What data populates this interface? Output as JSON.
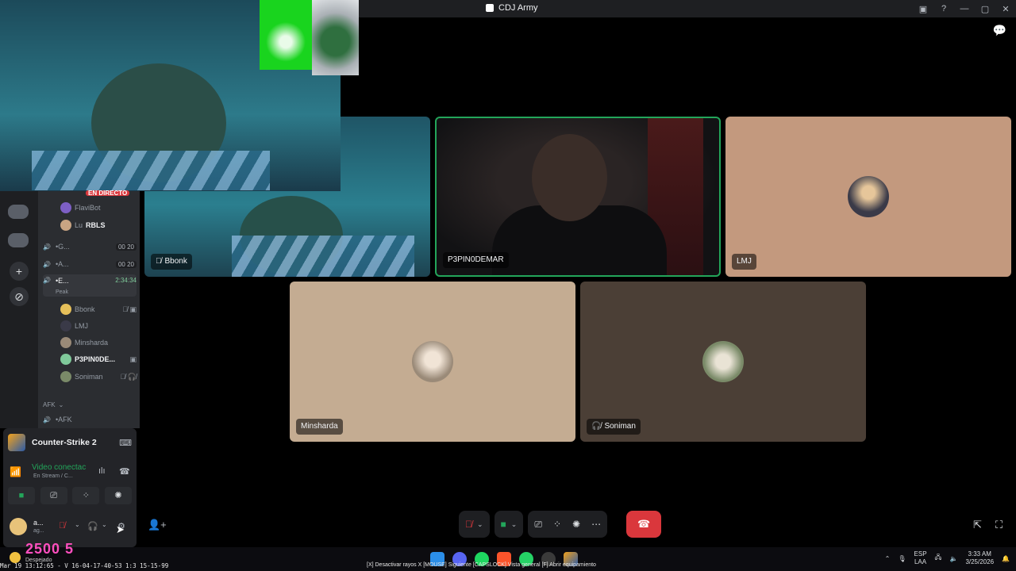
{
  "window": {
    "title": "CDJ Army"
  },
  "channels": {
    "live_badge": "EN DIRECTO",
    "bots": [
      {
        "name": "FlaviBot"
      },
      {
        "name": "Lu",
        "badge": "RBLS"
      }
    ],
    "voice": [
      {
        "name": "•G...",
        "count": "00",
        "limit": "20"
      },
      {
        "name": "•A...",
        "count": "00",
        "limit": "20"
      }
    ],
    "active_channel": {
      "name": "•E...",
      "timer": "2:34:34",
      "sub": "Peak"
    },
    "members": [
      "Bbonk",
      "LMJ",
      "Minsharda",
      "P3PIN0DE...",
      "Soniman"
    ],
    "afk_header": "AFK",
    "afk_channel": "•AFK"
  },
  "panel": {
    "game": "Counter-Strike 2",
    "voice_status": "Video conectac",
    "voice_sub": "En Stream / C...",
    "user_name": "a...",
    "user_tag": "ag..."
  },
  "tiles": {
    "bbonk": "Bbonk",
    "p3": "P3PIN0DEMAR",
    "lmj": "LMJ",
    "minsharda": "Minsharda",
    "soniman": "Soniman"
  },
  "colors": {
    "accent_green": "#23a55a",
    "danger_red": "#da373c",
    "sidebar": "#2b2d31"
  },
  "overlay": {
    "big": "2500  5",
    "despejado": "Despejado",
    "osd_left": "Mar 19 13:12:65 - V 16-04-17-40-53 1:3 15-15-99",
    "osd_right": "[X] Desactivar rayos X   [MOUSE] Siguiente   [CAPSLOCK] Vista general   [F] Abrir equipamiento"
  },
  "tray": {
    "lang": "ESP",
    "lang2": "LAA",
    "time": "3:33 AM",
    "date": "3/25/2026"
  }
}
